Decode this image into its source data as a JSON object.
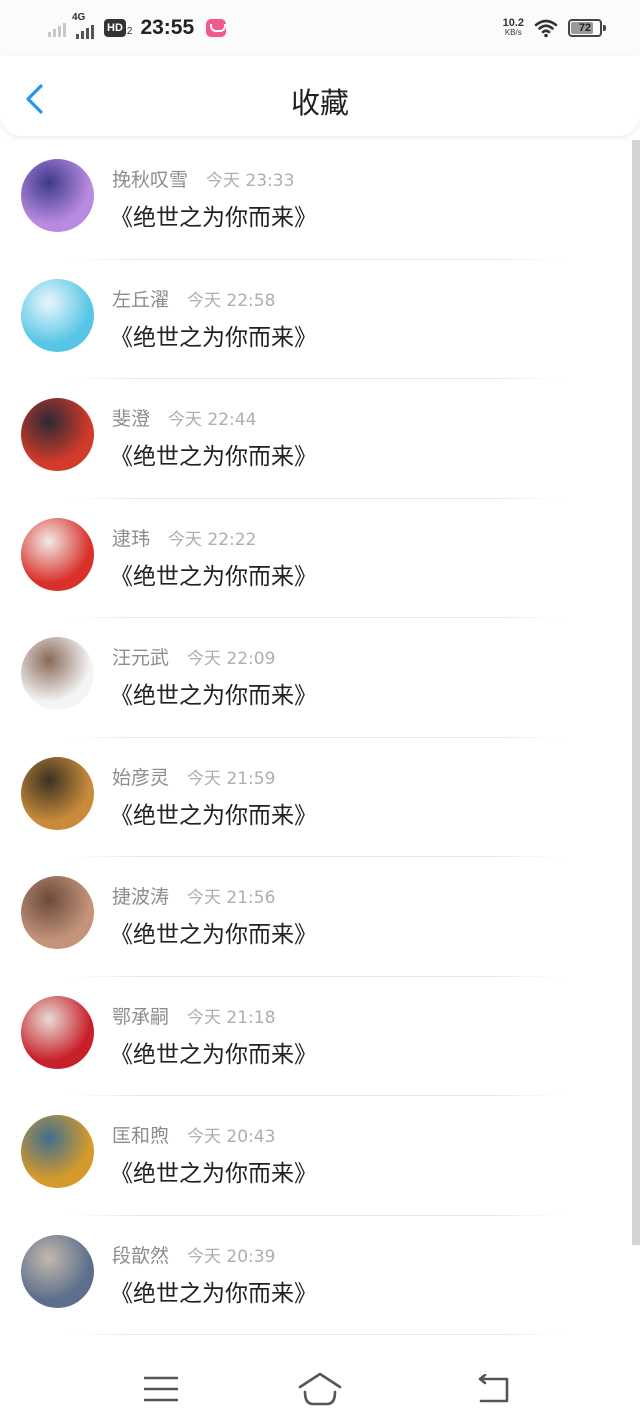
{
  "status_bar": {
    "network_type": "4G",
    "hd_label": "HD",
    "hd_sub": "2",
    "time": "23:55",
    "speed_value": "10.2",
    "speed_unit": "KB/s",
    "battery_level": "72",
    "battery_fraction": 0.72,
    "app_icon_color": "#f35a8c"
  },
  "header": {
    "title": "收藏",
    "back_icon": "chevron-left-icon",
    "accent_color": "#2196f3"
  },
  "favorites": [
    {
      "name": "挽秋叹雪",
      "time": "今天 23:33",
      "content": "《绝世之为你而来》",
      "avatar_colors": [
        "#b98be0",
        "#3d3a8c"
      ]
    },
    {
      "name": "左丘濯",
      "time": "今天 22:58",
      "content": "《绝世之为你而来》",
      "avatar_colors": [
        "#57c6e6",
        "#eaf6fb"
      ]
    },
    {
      "name": "斐澄",
      "time": "今天 22:44",
      "content": "《绝世之为你而来》",
      "avatar_colors": [
        "#d23a2a",
        "#2a2a35"
      ]
    },
    {
      "name": "逮玮",
      "time": "今天 22:22",
      "content": "《绝世之为你而来》",
      "avatar_colors": [
        "#d9302b",
        "#f1ece5"
      ]
    },
    {
      "name": "汪元武",
      "time": "今天 22:09",
      "content": "《绝世之为你而来》",
      "avatar_colors": [
        "#f4f4f4",
        "#8a6a5a"
      ]
    },
    {
      "name": "始彦灵",
      "time": "今天 21:59",
      "content": "《绝世之为你而来》",
      "avatar_colors": [
        "#c98b3a",
        "#3c3222"
      ]
    },
    {
      "name": "捷波涛",
      "time": "今天 21:56",
      "content": "《绝世之为你而来》",
      "avatar_colors": [
        "#c4937a",
        "#6a4a3a"
      ]
    },
    {
      "name": "鄂承嗣",
      "time": "今天 21:18",
      "content": "《绝世之为你而来》",
      "avatar_colors": [
        "#c8202a",
        "#e8dcd6"
      ]
    },
    {
      "name": "匡和煦",
      "time": "今天 20:43",
      "content": "《绝世之为你而来》",
      "avatar_colors": [
        "#d59a2c",
        "#3f6f90"
      ]
    },
    {
      "name": "段歆然",
      "time": "今天 20:39",
      "content": "《绝世之为你而来》",
      "avatar_colors": [
        "#5d6f8c",
        "#c2b9ad"
      ]
    }
  ],
  "nav_bar": {
    "menu_icon": "menu-icon",
    "home_icon": "home-icon",
    "back_icon": "back-arrow-icon"
  }
}
